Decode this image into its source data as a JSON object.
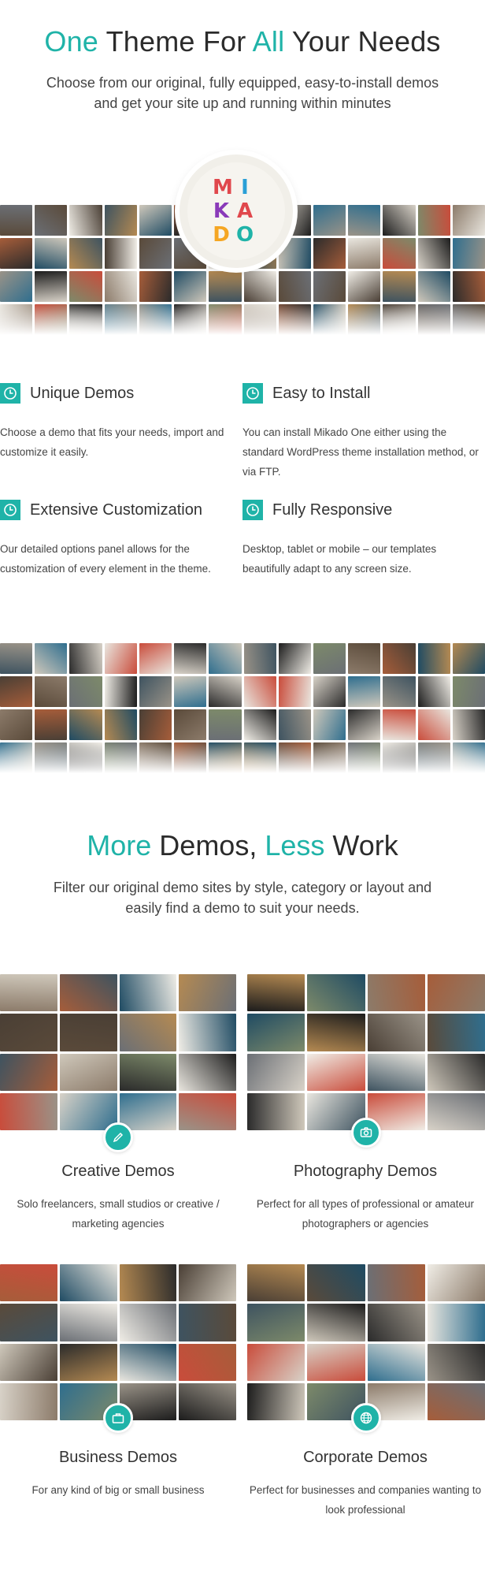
{
  "hero": {
    "title_part1": "One",
    "title_part2": " Theme For ",
    "title_part3": "All",
    "title_part4": " Your Needs",
    "subtitle_line1": "Choose from our original, fully equipped, easy-to-install demos",
    "subtitle_line2": "and get your site up and running within minutes"
  },
  "logo": {
    "row1": [
      "M",
      "I"
    ],
    "row2": [
      "K",
      "A"
    ],
    "row3": [
      "D",
      "O"
    ],
    "colors": [
      "#e0474c",
      "#2a9fd6",
      "#8a3ab9",
      "#e0474c",
      "#f5a623",
      "#1fb3a8"
    ]
  },
  "features": [
    {
      "title": "Unique Demos",
      "text": "Choose a demo that fits your needs, import and customize it easily.",
      "icon": "clock-icon"
    },
    {
      "title": "Easy to Install",
      "text": "You can install Mikado One either using the standard WordPress theme installation method, or via FTP.",
      "icon": "clock-icon"
    },
    {
      "title": "Extensive Customization",
      "text": "Our detailed options panel allows for the customization of every element in the theme.",
      "icon": "clock-icon"
    },
    {
      "title": "Fully Responsive",
      "text": "Desktop, tablet or mobile – our templates beautifully adapt to any screen size.",
      "icon": "clock-icon"
    }
  ],
  "section2": {
    "title_part1": "More",
    "title_part2": " Demos, ",
    "title_part3": "Less",
    "title_part4": " Work",
    "subtitle_line1": "Filter our original demo sites by style, category or layout and",
    "subtitle_line2": "easily find a demo to suit your needs."
  },
  "demos": [
    {
      "title": "Creative Demos",
      "text": "Solo freelancers, small studios or creative / marketing agencies",
      "icon": "pencil-icon"
    },
    {
      "title": "Photography Demos",
      "text": "Perfect for all types of professional or amateur photographers or agencies",
      "icon": "camera-icon"
    },
    {
      "title": "Business Demos",
      "text": "For any kind of big or small business",
      "icon": "briefcase-icon"
    },
    {
      "title": "Corporate Demos",
      "text": "Perfect for businesses and companies wanting to look professional",
      "icon": "globe-icon"
    }
  ],
  "colors": {
    "accent": "#1fb3a8"
  }
}
